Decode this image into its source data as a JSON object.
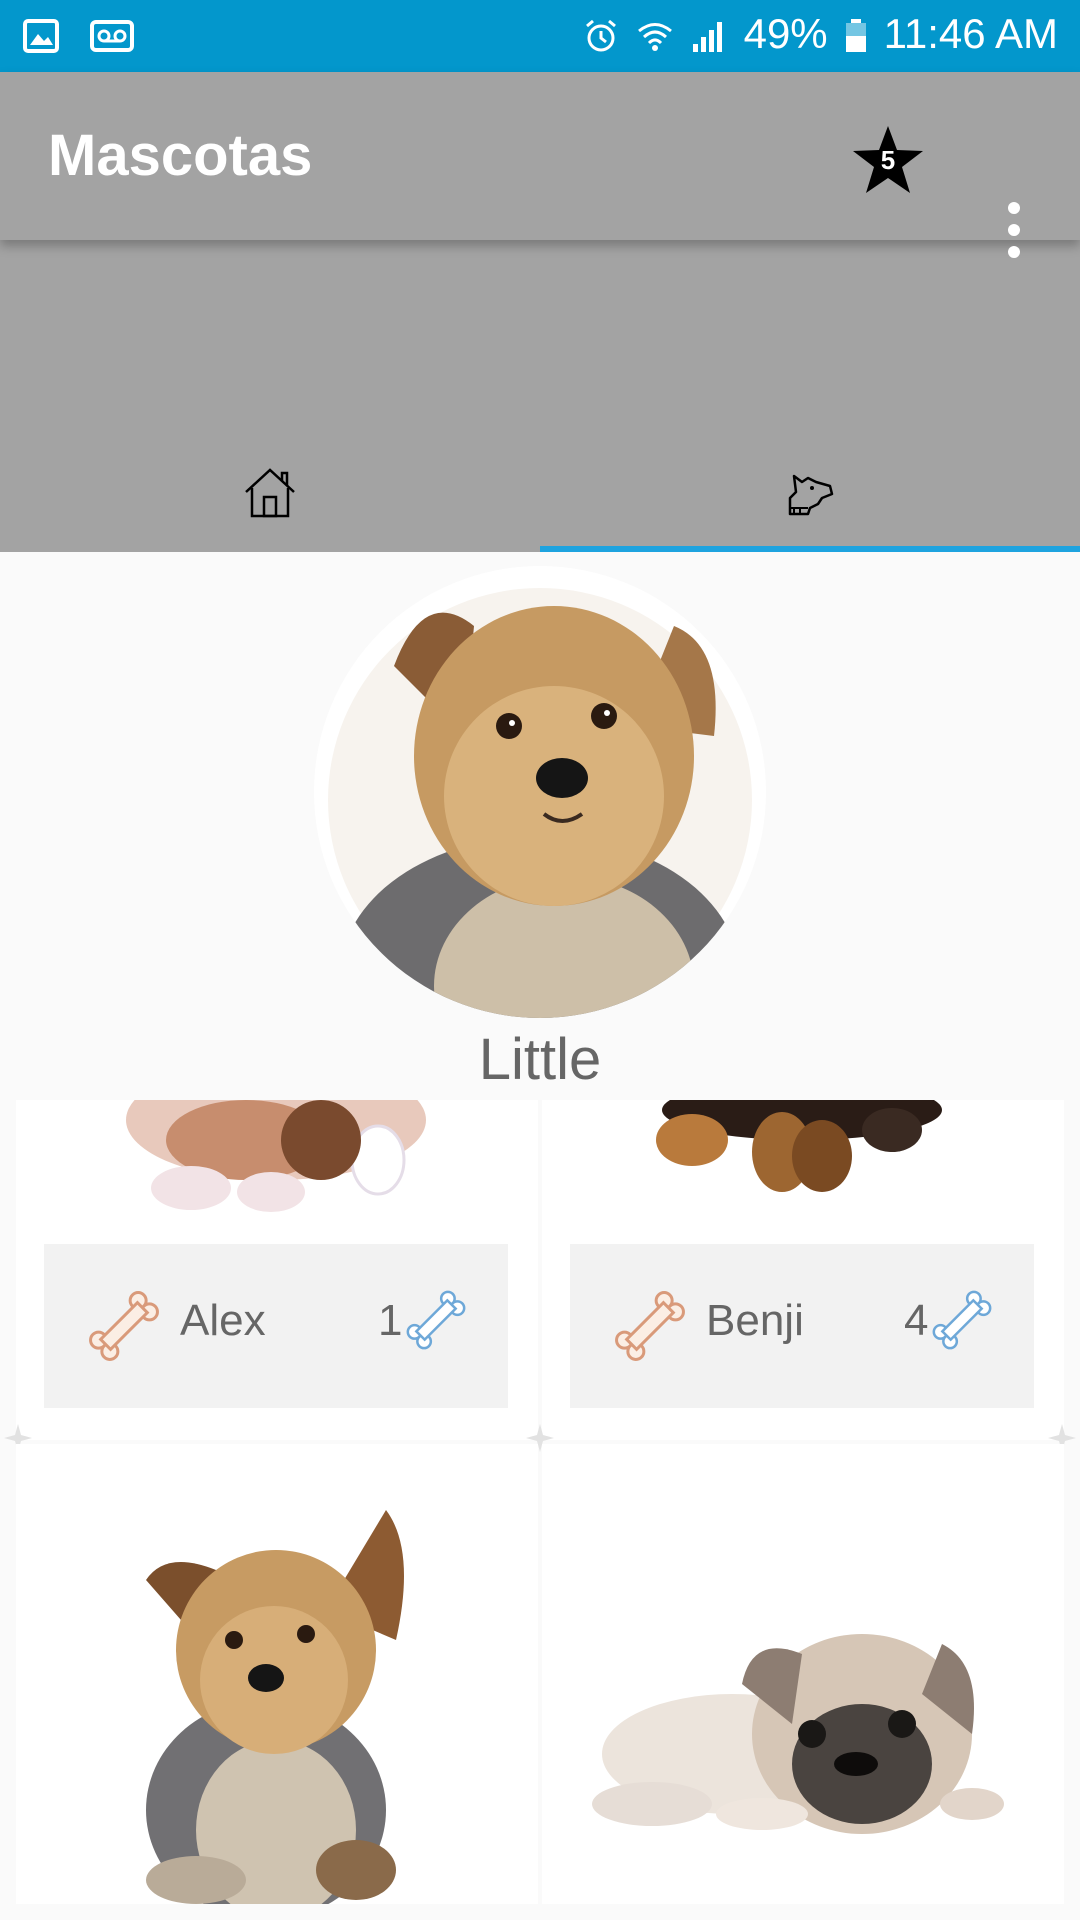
{
  "status_bar": {
    "battery": "49%",
    "time": "11:46 AM",
    "icons": [
      "gallery-icon",
      "voicemail-icon",
      "alarm-icon",
      "wifi-icon",
      "signal-icon",
      "battery-icon"
    ]
  },
  "app_bar": {
    "title": "Mascotas",
    "favorites_count": "5"
  },
  "tabs": [
    {
      "icon": "home-icon",
      "selected": false
    },
    {
      "icon": "dog-icon",
      "selected": true
    }
  ],
  "profile": {
    "name": "Little"
  },
  "pets": [
    {
      "name": "Alex",
      "likes": "1"
    },
    {
      "name": "Benji",
      "likes": "4"
    }
  ],
  "colors": {
    "status_bar": "#0397cc",
    "app_bar": "#a3a3a3",
    "tab_indicator": "#1ea3df",
    "bone_left": "#d99a7a",
    "bone_right": "#6ea8d8"
  }
}
